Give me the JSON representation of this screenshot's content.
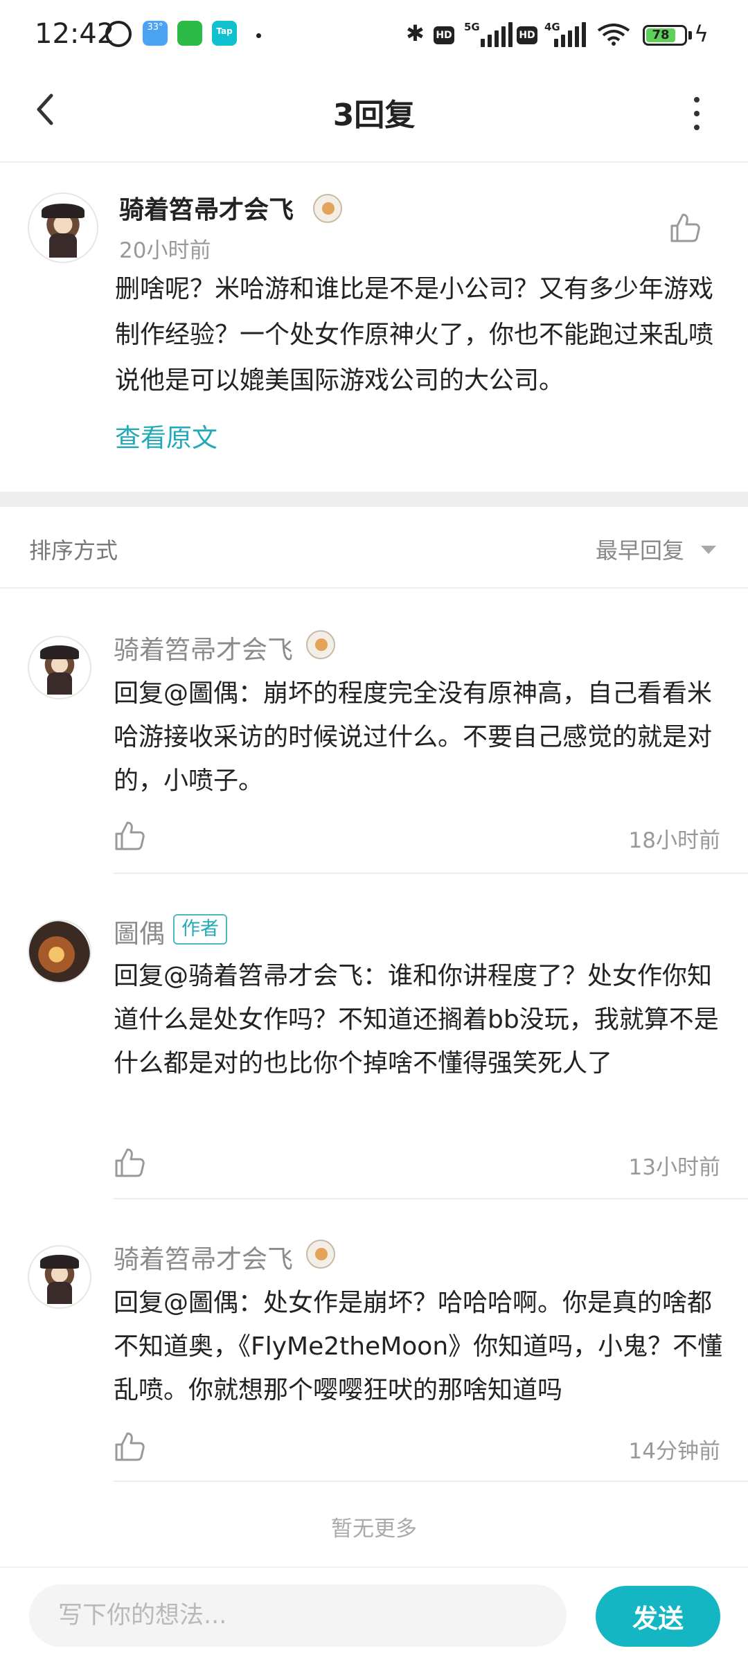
{
  "status_bar": {
    "time": "12:42",
    "weather_temp": "33°",
    "tap_label": "Tap",
    "network_1": "5G",
    "network_2": "4G",
    "hd_label": "HD",
    "battery": "78"
  },
  "header": {
    "title": "3回复"
  },
  "original_post": {
    "author": "骑着笤帚才会飞",
    "time": "20小时前",
    "text": "删啥呢？米哈游和谁比是不是小公司？又有多少年游戏制作经验？一个处女作原神火了，你也不能跑过来乱喷说他是可以媲美国际游戏公司的大公司。",
    "view_original": "查看原文"
  },
  "sort": {
    "label": "排序方式",
    "value": "最早回复"
  },
  "replies": [
    {
      "author": "骑着笤帚才会飞",
      "text": "回复@圖偶：崩坏的程度完全没有原神高，自己看看米哈游接收采访的时候说过什么。不要自己感觉的就是对的，小喷子。",
      "time": "18小时前"
    },
    {
      "author": "圖偶",
      "tag": "作者",
      "text": "回复@骑着笤帚才会飞：谁和你讲程度了？处女作你知道什么是处女作吗？不知道还搁着bb没玩，我就算不是什么都是对的也比你个掉啥不懂得强笑死人了",
      "time": "13小时前"
    },
    {
      "author": "骑着笤帚才会飞",
      "text": "回复@圖偶：处女作是崩坏？哈哈哈啊。你是真的啥都不知道奥，《FlyMe2theMoon》你知道吗，小鬼？不懂乱喷。你就想那个嘤嘤狂吠的那啥知道吗",
      "time": "14分钟前"
    }
  ],
  "footer": {
    "no_more": "暂无更多",
    "input_placeholder": "写下你的想法...",
    "send_label": "发送"
  }
}
